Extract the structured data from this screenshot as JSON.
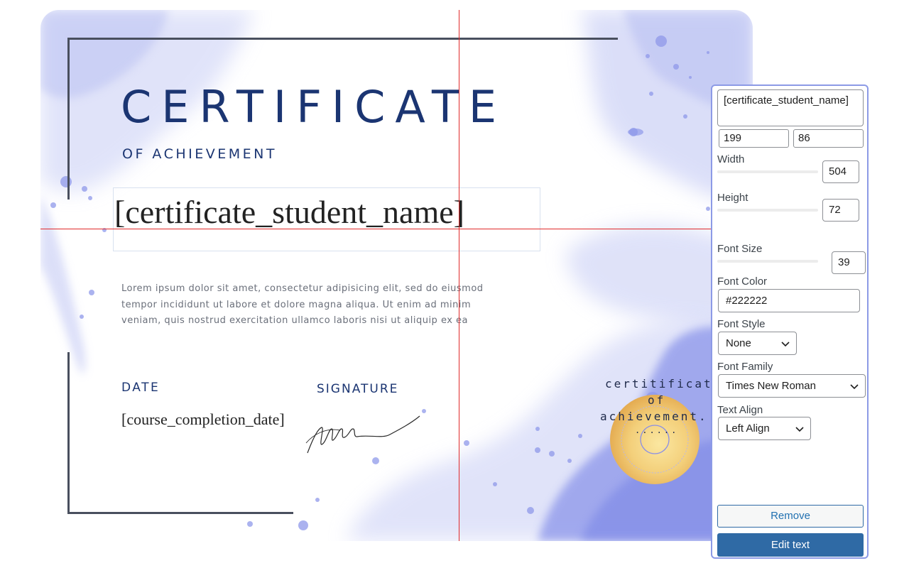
{
  "certificate": {
    "title": "CERTIFICATE",
    "subtitle": "OF ACHIEVEMENT",
    "student_name": "[certificate_student_name]",
    "body_lines": [
      "Lorem ipsum dolor sit amet, consectetur adipisicing elit, sed do eiusmod",
      "tempor incididunt ut labore et dolore magna aliqua. Ut enim ad minim",
      "veniam, quis nostrud exercitation ullamco laboris nisi ut aliquip ex ea"
    ],
    "date_label": "DATE",
    "date_value": "[course_completion_date]",
    "signature_label": "SIGNATURE",
    "seal_lines": [
      "certitificate",
      "of",
      "achievement.",
      "......"
    ]
  },
  "panel": {
    "text_value": "[certificate_student_name]",
    "pos_x": "199",
    "pos_y": "86",
    "width_label": "Width",
    "width_value": "504",
    "height_label": "Height",
    "height_value": "72",
    "font_size_label": "Font Size",
    "font_size_value": "39",
    "font_color_label": "Font Color",
    "font_color_value": "#222222",
    "font_style_label": "Font Style",
    "font_style_value": "None",
    "font_family_label": "Font Family",
    "font_family_value": "Times New Roman",
    "text_align_label": "Text Align",
    "text_align_value": "Left Align",
    "remove_label": "Remove",
    "edit_label": "Edit text"
  },
  "colors": {
    "title": "#1b3572",
    "guide": "#e12a2a",
    "panel_border": "#8c9ae6",
    "button_primary": "#2f6aa5",
    "watercolor": "#8e98ea"
  },
  "icons": [
    "chevron-down-icon",
    "gold-seal-icon",
    "signature-icon"
  ]
}
